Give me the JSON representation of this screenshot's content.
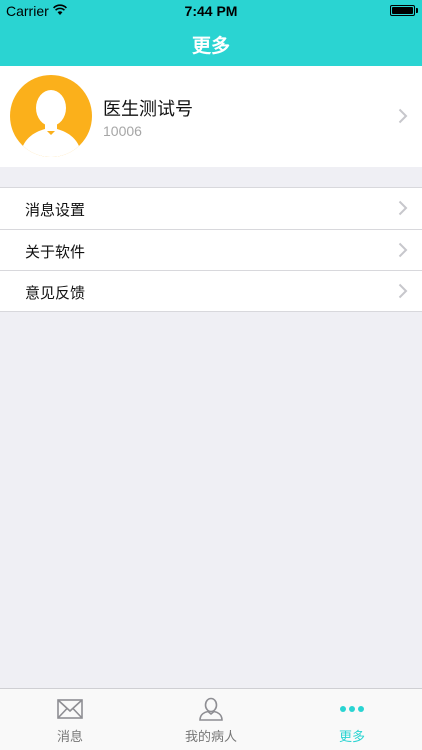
{
  "status_bar": {
    "carrier": "Carrier",
    "time": "7:44 PM"
  },
  "nav": {
    "title": "更多"
  },
  "profile": {
    "name": "医生测试号",
    "id": "10006",
    "avatar_color": "#fbb01b"
  },
  "menu": {
    "items": [
      {
        "label": "消息设置"
      },
      {
        "label": "关于软件"
      },
      {
        "label": "意见反馈"
      }
    ]
  },
  "tabbar": {
    "tabs": [
      {
        "label": "消息",
        "icon": "envelope-icon"
      },
      {
        "label": "我的病人",
        "icon": "person-icon"
      },
      {
        "label": "更多",
        "icon": "more-dots-icon"
      }
    ],
    "active_tab": "更多"
  },
  "colors": {
    "accent": "#2ad4d2",
    "background": "#efeff4"
  }
}
